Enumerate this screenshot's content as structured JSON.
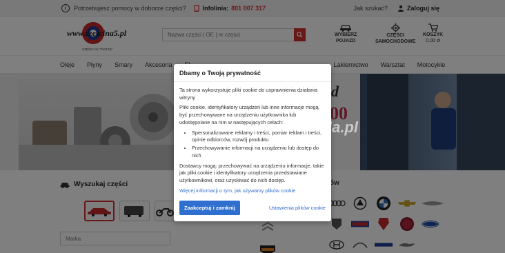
{
  "topbar": {
    "help_text": "Potrzebujesz pomocy w doborze części?",
    "hotline_label": "Infolinia:",
    "hotline_number": "801 007 317",
    "how_search": "Jak szukać?",
    "login": "Zaloguj się"
  },
  "header": {
    "logo_text": "www.czescina5.pl",
    "logo_sub": "CZĘŚCI NA \"PIĄTKĘ\"",
    "search_placeholder": "Nazwa części | OE | nr części",
    "select_vehicle": [
      "WYBIERZ",
      "POJAZD"
    ],
    "car_parts": [
      "CZĘŚCI",
      "SAMOCHODOWE"
    ],
    "cart_label": "KOSZYK",
    "cart_amount": "0.00 zł"
  },
  "nav": {
    "items": [
      "Oleje",
      "Płyny",
      "Smary",
      "Akcesoria",
      "El",
      "Lakiernictwo",
      "Warsztat",
      "Motocykle"
    ]
  },
  "banner": {
    "promo_d": "d",
    "promo_n": "00",
    "promo_i": "i",
    "watermark": "www.mojeskarbzda.pl"
  },
  "parts_search": {
    "title": "Wyszukaj części",
    "marka_placeholder": "Marka"
  },
  "brands": {
    "title_suffix": "ów",
    "row1": [
      "AUDI",
      "ALFA",
      "BMW",
      "CHEVROLET",
      "CHRYSLER"
    ],
    "row2": [
      "DACIA",
      "DAF",
      "DODGE",
      "FIAT",
      "FORD"
    ],
    "row3": [
      "HYUNDAI",
      "INFINITI",
      "IVECO",
      "JAGUAR"
    ],
    "extra": [
      "CITROEN",
      "HARLEY-DAVIDSON"
    ]
  },
  "modal": {
    "title": "Dbamy o Twoją prywatność",
    "p1": "Ta strona wykorzystuje pliki cookie do usprawnienia działania witryny",
    "p2": "Pliki cookie, identyfikatory urządzeń lub inne informacje mogą być przechowywane na urządzeniu użytkownika lub udostępniane na nim w następujących celach:",
    "bullets": [
      "Spersonalizowane reklamy i treści, pomiar reklam i treści, opinie odbiorców, rozwój produktu",
      "Przechowywanie informacji na urządzeniu lub dostęp do nich"
    ],
    "p3": "Dostawcy mogą: przechowywać na urządzeniu informacje, takie jak pliki cookie i identyfikatory urządzenia przedstawiane użytkownikowi, oraz uzyskiwać do nich dostęp.",
    "more_link": "Więcej informacji o tym, jak używamy plików cookie",
    "accept": "Zaakceptuj i zamknij",
    "settings": "Ustawienia plików cookie"
  },
  "colors": {
    "accent": "#d32f2f",
    "link": "#2f6fd0"
  }
}
